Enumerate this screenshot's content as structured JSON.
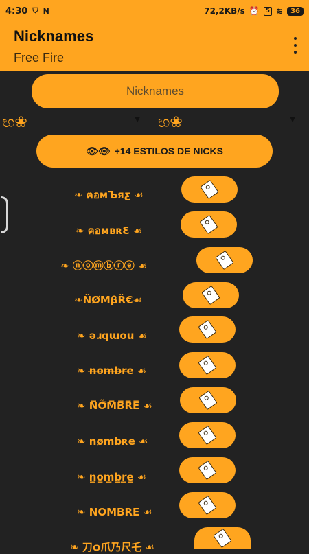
{
  "status_bar": {
    "time": "4:30",
    "network_speed": "72,2KB/s",
    "sim_label": "5",
    "battery": "36"
  },
  "app_bar": {
    "title": "Nicknames",
    "subtitle": "Free Fire"
  },
  "search": {
    "placeholder": "Nicknames"
  },
  "spinners": [
    {
      "value": "භ❀"
    },
    {
      "value": "භ❀"
    }
  ],
  "styles_button": {
    "label": "+14 ESTILOS DE NICKS",
    "icon": "👁👁"
  },
  "nicknames": [
    {
      "text": "❧ ฅอмЪяƹ ☙"
    },
    {
      "text": "❧ ฅอмвʀƐ ☙"
    },
    {
      "text": "❧ ⓝⓞⓜⓑⓡⓔ ☙"
    },
    {
      "text": "❧ŇØMβŘ€☙"
    },
    {
      "text": "❧ ǝɹqɯou ☙"
    },
    {
      "text": "❧ n̶o̶m̶b̶r̶e̶ ☙"
    },
    {
      "text": "❧ N̿Õ̿M̿B̿R̿E̿ ☙"
    },
    {
      "text": "❧ nømbʀe ☙"
    },
    {
      "text": "❧ n̳o̳m̳b̳r̳e̳ ☙"
    },
    {
      "text": "❧ NOMBRE ☙"
    },
    {
      "text": "❧ 刀໐爪乃尺乇 ☙"
    }
  ]
}
